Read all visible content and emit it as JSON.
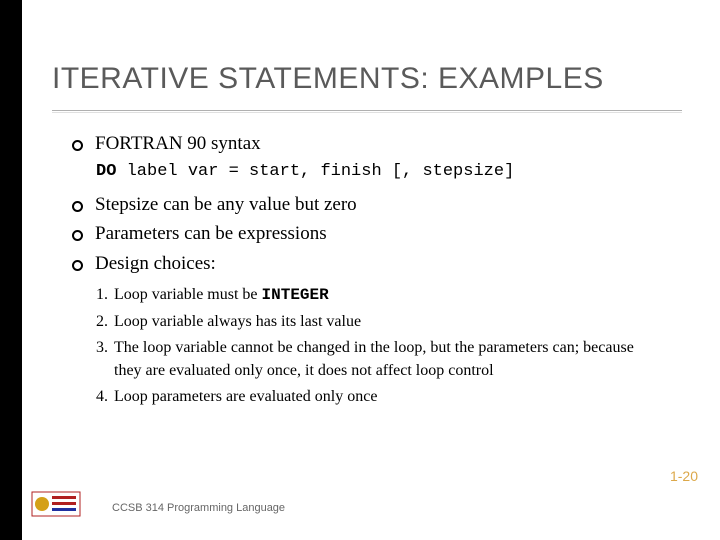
{
  "title": "ITERATIVE STATEMENTS: EXAMPLES",
  "bullets": {
    "main": "FORTRAN 90 syntax",
    "code_kw": "DO",
    "code_rest": " label var = start, finish [, stepsize]",
    "sub1": "Stepsize can be any value but zero",
    "sub2": "Parameters can be expressions",
    "sub3": "Design choices:"
  },
  "numbered": {
    "n1_pre": "Loop variable must be ",
    "n1_code": "INTEGER",
    "n2": "Loop variable always has its last value",
    "n3": "The loop variable cannot be changed in the loop, but the parameters can; because they are evaluated only once, it does not affect loop control",
    "n4": "Loop parameters are evaluated only once",
    "num1": "1.",
    "num2": "2.",
    "num3": "3.",
    "num4": "4."
  },
  "slide_number": "1-20",
  "footer": "CCSB 314 Programming Language"
}
